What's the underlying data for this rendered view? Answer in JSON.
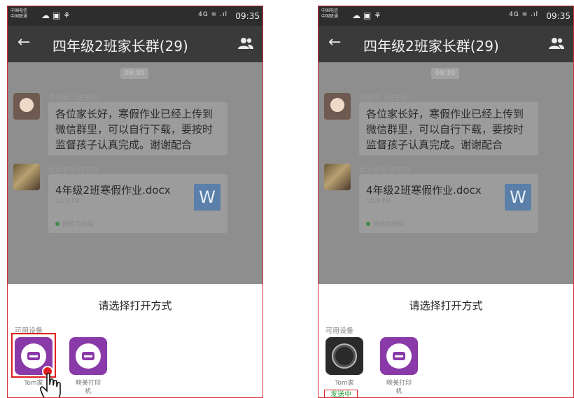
{
  "status_bar": {
    "carrier_line1": "中国电信",
    "carrier_line2": "中国联通",
    "signal_text": "4G ≋ .ıl",
    "time": "09:35"
  },
  "chat_header": {
    "group_title": "四年级2班家长群(29)",
    "back_icon": "arrow-left",
    "members_icon": "group-people"
  },
  "chat": {
    "timestamp": "09:30",
    "messages": [
      {
        "sender": "李老师（班主任）",
        "lines": [
          "各位家长好，寒假作业已经上传到",
          "微信群里，可以自行下载，要按时",
          "监督孩子认真完成。谢谢配合"
        ]
      },
      {
        "sender": "数学老师·庄若诗",
        "file_name": "4年级2班寒假作业.docx",
        "file_size": "10.9 KB",
        "file_icon_letter": "W",
        "file_source": "微信电脑版"
      }
    ]
  },
  "open_with_sheet": {
    "title": "请选择打开方式",
    "devices_label": "可用设备",
    "devices": [
      {
        "name": "Tom家"
      },
      {
        "name_line1": "映美打印",
        "name_line2": "机"
      }
    ],
    "sending_status": "发送中"
  },
  "colors": {
    "device_tile": "#8a3aa8",
    "annotation_red": "#e02020",
    "sending_green": "#2a9a3a"
  }
}
